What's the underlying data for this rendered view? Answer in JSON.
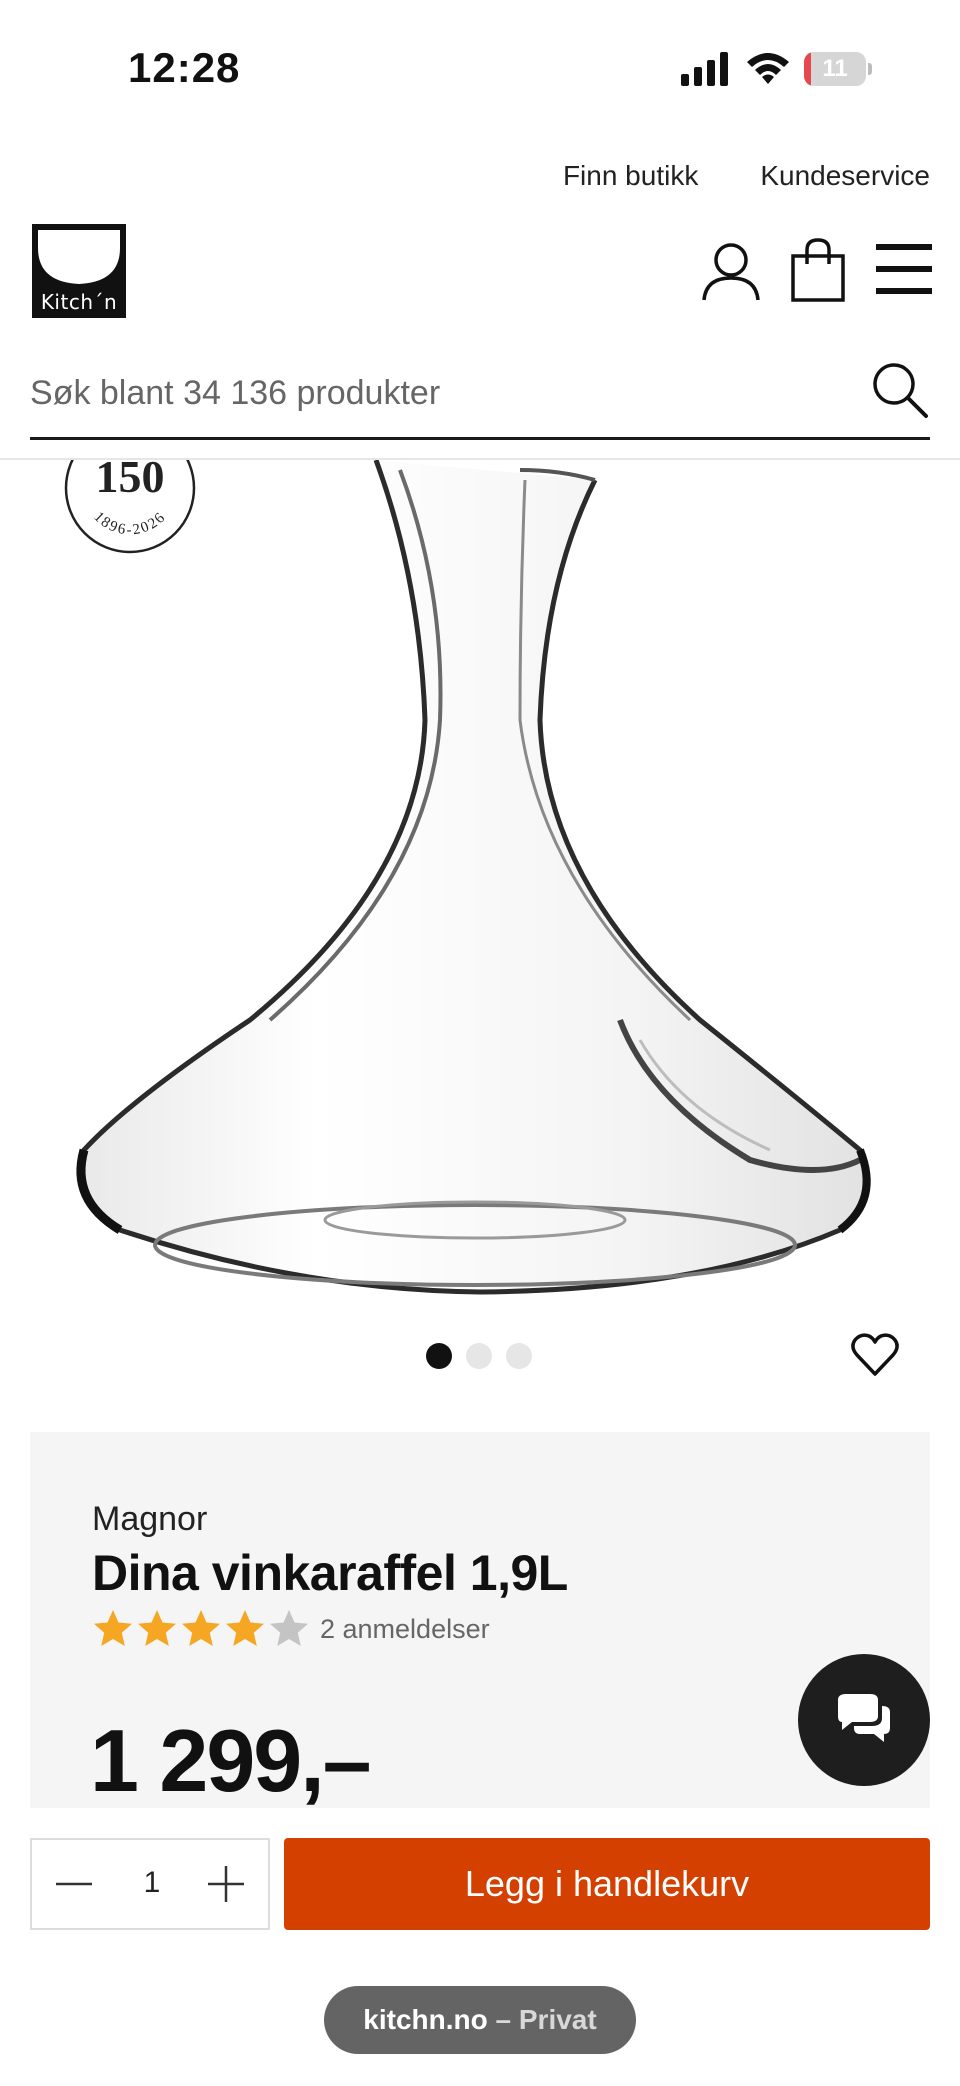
{
  "status_bar": {
    "time": "12:28",
    "battery_level": "11",
    "battery_fraction": 0.11,
    "icons": [
      "signal-icon",
      "wifi-icon",
      "battery-icon"
    ]
  },
  "top_links": {
    "find_store": "Finn butikk",
    "customer_service": "Kundeservice"
  },
  "header": {
    "logo_text": "Kitch´n",
    "icons": [
      "user-icon",
      "shopping-bag-icon",
      "hamburger-menu-icon"
    ]
  },
  "search": {
    "placeholder": "Søk blant 34 136 produkter"
  },
  "badge": {
    "number": "150",
    "years": "1896-2026"
  },
  "carousel": {
    "total": 3,
    "active_index": 0
  },
  "product": {
    "brand": "Magnor",
    "title": "Dina vinkaraffel 1,9L",
    "rating": 4,
    "rating_max": 5,
    "reviews_label": "2 anmeldelser",
    "price": "1 299,–"
  },
  "cart": {
    "quantity": "1",
    "add_label": "Legg i handlekurv"
  },
  "browser": {
    "domain": "kitchn.no",
    "mode": " – Privat"
  },
  "colors": {
    "accent": "#d44000",
    "star": "#f5a623",
    "star_empty": "#c4c4c4",
    "panel_bg": "#f5f5f5",
    "battery_low": "#e5484d"
  }
}
